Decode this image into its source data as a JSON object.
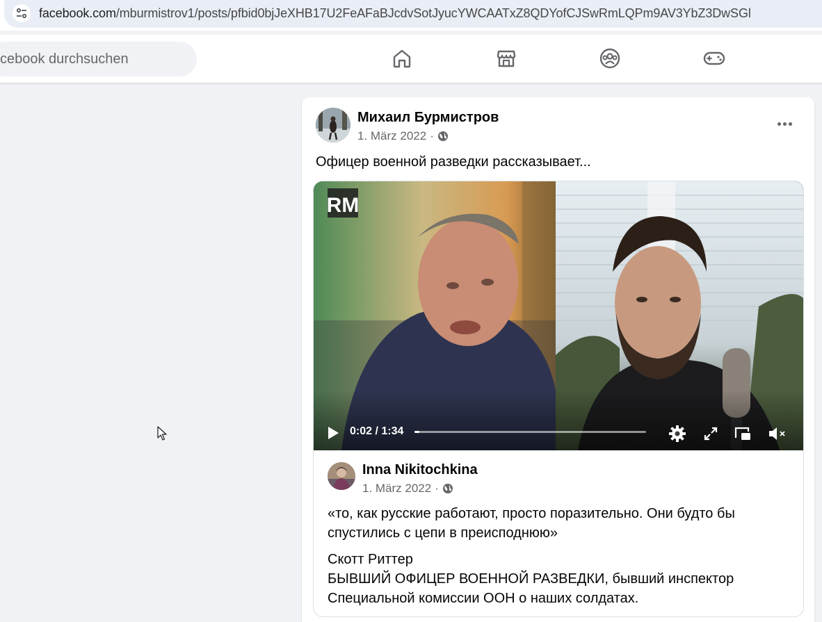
{
  "browser": {
    "url_host": "facebook.com",
    "url_path": "/mburmistrov1/posts/pfbid0bjJeXHB17U2FeAFaBJcdvSotJyucYWCAATxZ8QDYofCJSwRmLQPm9AV3YbZ3DwSGl",
    "site_info_icon": "tune-icon"
  },
  "nav": {
    "search_placeholder": "Facebook durchsuchen",
    "search_visible_text": "cebook durchsuchen",
    "icons": [
      "home-icon",
      "marketplace-icon",
      "groups-icon",
      "gaming-icon"
    ]
  },
  "post": {
    "author": "Михаил Бурмистров",
    "date": "1. März 2022",
    "separator": "·",
    "audience_icon": "globe-icon",
    "more_icon": "more-options-icon",
    "text": "Офицер военной разведки рассказывает..."
  },
  "video": {
    "watermark": "RM",
    "current_time": "0:02",
    "duration": "1:34",
    "time_label": "0:02 / 1:34",
    "progress_fraction": 0.02,
    "controls": [
      "play-icon",
      "settings-icon",
      "fullscreen-icon",
      "picture-in-picture-icon",
      "muted-volume-icon"
    ]
  },
  "shared": {
    "author": "Inna Nikitochkina",
    "date": "1. März 2022",
    "separator": "·",
    "quote_line1": "«то, как русские работают, просто поразительно. Они будто бы",
    "quote_line2": "спустились с цепи в преисподнюю»",
    "attribution_name": "Скотт Риттер",
    "attribution_line1": "БЫВШИЙ ОФИЦЕР ВОЕННОЙ РАЗВЕДКИ, бывший инспектор",
    "attribution_line2": "Специальной комиссии ООН о наших солдатах."
  }
}
